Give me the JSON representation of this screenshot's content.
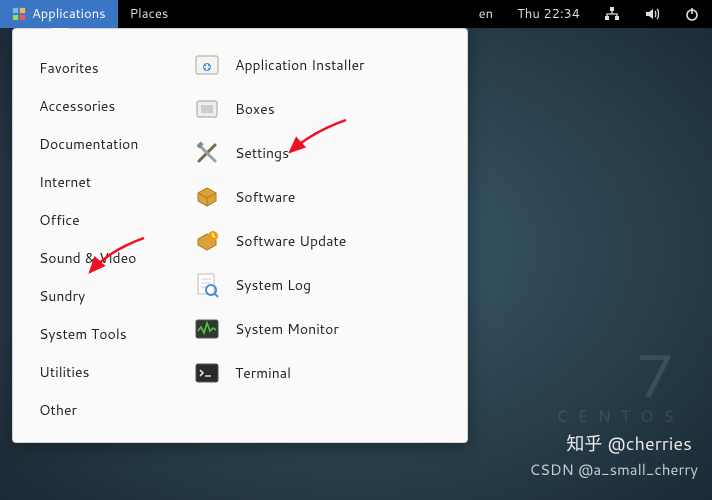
{
  "topbar": {
    "applications": "Applications",
    "places": "Places",
    "lang": "en",
    "clock": "Thu 22:34"
  },
  "menu": {
    "categories": [
      "Favorites",
      "Accessories",
      "Documentation",
      "Internet",
      "Office",
      "Sound & Video",
      "Sundry",
      "System Tools",
      "Utilities",
      "Other"
    ],
    "apps": [
      {
        "icon": "installer",
        "label": "Application Installer"
      },
      {
        "icon": "boxes",
        "label": "Boxes"
      },
      {
        "icon": "settings",
        "label": "Settings"
      },
      {
        "icon": "software",
        "label": "Software"
      },
      {
        "icon": "update",
        "label": "Software Update"
      },
      {
        "icon": "syslog",
        "label": "System Log"
      },
      {
        "icon": "sysmon",
        "label": "System Monitor"
      },
      {
        "icon": "terminal",
        "label": "Terminal"
      }
    ]
  },
  "brand": {
    "seven": "7",
    "centos": "CENTOS"
  },
  "watermark1": "知乎 @cherries",
  "watermark2": "CSDN @a_small_cherry"
}
